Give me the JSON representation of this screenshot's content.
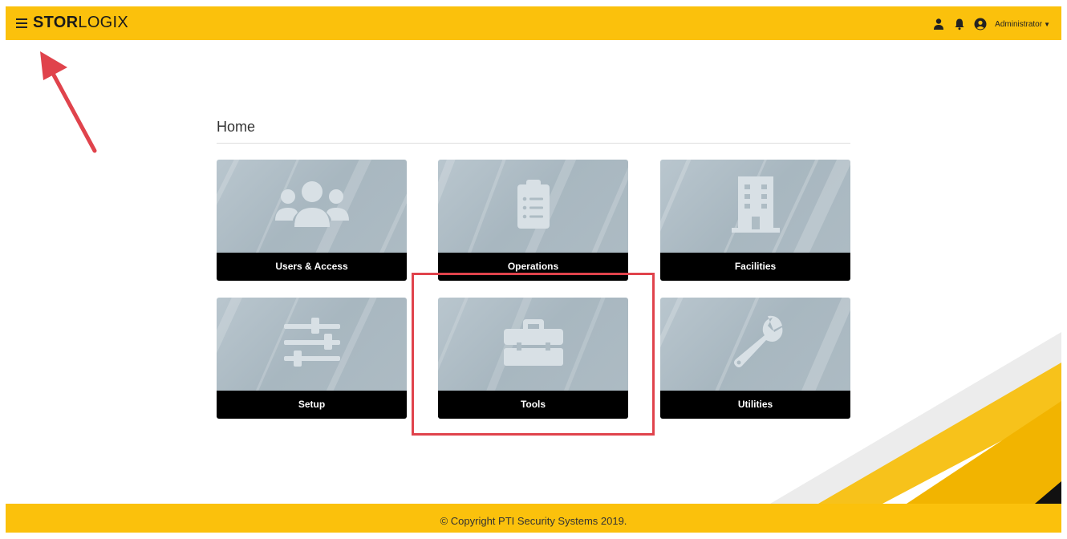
{
  "header": {
    "brand_bold": "STOR",
    "brand_regular": "LOGIX",
    "user_label": "Administrator",
    "icons": [
      "menu-icon",
      "user-icon",
      "bell-icon",
      "account-circle-icon",
      "caret-down-icon"
    ]
  },
  "page": {
    "title": "Home"
  },
  "tiles": [
    {
      "label": "Users & Access",
      "icon": "users-icon"
    },
    {
      "label": "Operations",
      "icon": "clipboard-list-icon"
    },
    {
      "label": "Facilities",
      "icon": "building-icon"
    },
    {
      "label": "Setup",
      "icon": "sliders-icon"
    },
    {
      "label": "Tools",
      "icon": "toolbox-icon"
    },
    {
      "label": "Utilities",
      "icon": "wrench-icon"
    }
  ],
  "footer": {
    "copyright": "© Copyright PTI Security Systems 2019."
  },
  "colors": {
    "brand_yellow": "#fbc10c",
    "tile_label_bg": "#000000",
    "annotation_red": "#e0434c"
  }
}
